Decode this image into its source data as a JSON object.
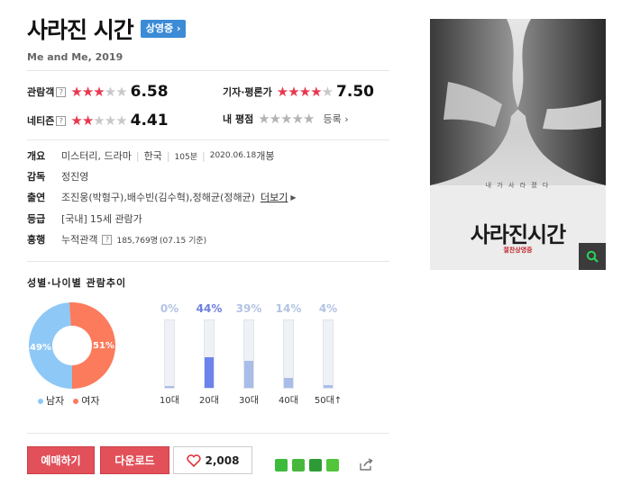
{
  "movie": {
    "title": "사라진 시간",
    "status_badge": "상영중 ›",
    "subtitle": "Me and Me, 2019"
  },
  "ratings": {
    "audience": {
      "label": "관람객",
      "help": "?",
      "stars": 3.3,
      "score": "6.58"
    },
    "critics": {
      "label": "기자·평론가",
      "stars": 3.75,
      "score": "7.50"
    },
    "netizen": {
      "label": "네티즌",
      "help": "?",
      "stars": 2.2,
      "score": "4.41"
    },
    "my": {
      "label": "내 평점",
      "stars": 0,
      "action": "등록 ›"
    }
  },
  "info": {
    "summary": {
      "label": "개요",
      "genre": "미스터리, 드라마",
      "country": "한국",
      "runtime": "105분",
      "release_date": "2020.06.18",
      "release_suffix": " 개봉"
    },
    "director": {
      "label": "감독",
      "value": "정진영"
    },
    "cast": {
      "label": "출연",
      "actors": [
        {
          "name": "조진웅",
          "role": "(박형구)"
        },
        {
          "name": "배수빈",
          "role": "(김수혁)"
        },
        {
          "name": "정해균",
          "role": "(정해균)"
        }
      ],
      "more": "더보기",
      "sep": ", "
    },
    "grade": {
      "label": "등급",
      "prefix": "[국내]",
      "value": "15세 관람가"
    },
    "box_office": {
      "label": "흥행",
      "prefix": "누적관객",
      "help": "?",
      "value": "185,769명",
      "note": "(07.15 기준)"
    }
  },
  "poster": {
    "tagline": "내 가 사 라 졌 다",
    "title": "사라진시간",
    "subtitle": "절찬상영중"
  },
  "demographics": {
    "title": "성별·나이별 관람추이",
    "legend": {
      "male": "남자",
      "female": "여자"
    },
    "colors": {
      "male": "#8ec8f6",
      "female": "#fb7b5c"
    }
  },
  "chart_data": {
    "type": "pie",
    "labels": [
      "남자",
      "여자"
    ],
    "values": [
      49,
      51
    ],
    "value_labels": [
      "49%",
      "51%"
    ]
  },
  "age_chart": {
    "type": "bar",
    "categories": [
      "10대",
      "20대",
      "30대",
      "40대",
      "50대↑"
    ],
    "values": [
      0,
      44,
      39,
      14,
      4
    ],
    "value_labels": [
      "0%",
      "44%",
      "39%",
      "14%",
      "4%"
    ],
    "highlight_index": 1,
    "ylim": [
      0,
      100
    ]
  },
  "actions": {
    "book": "예매하기",
    "download": "다운로드",
    "likes": "2,008"
  }
}
